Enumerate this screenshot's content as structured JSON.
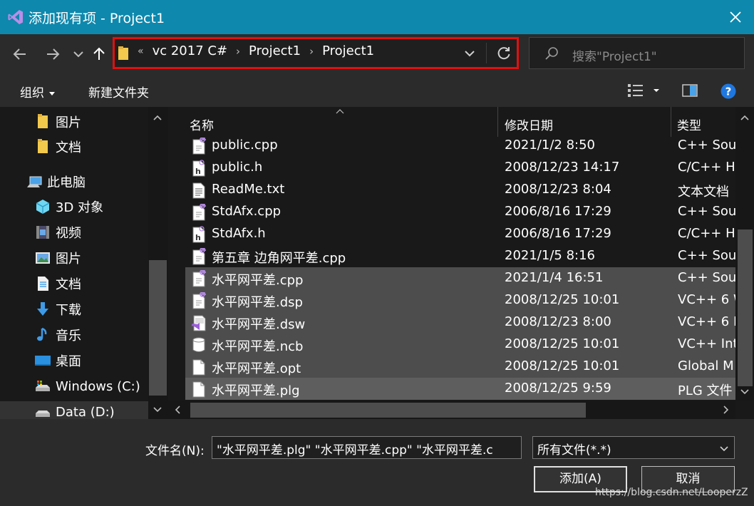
{
  "window": {
    "title": "添加现有项 - Project1",
    "close_label": "✕"
  },
  "address_bar": {
    "overflow": "«",
    "crumbs": [
      "vc 2017 C#",
      "Project1",
      "Project1"
    ]
  },
  "search": {
    "placeholder": "搜索\"Project1\""
  },
  "toolbar": {
    "organize": "组织",
    "new_folder": "新建文件夹"
  },
  "sidebar": {
    "items": [
      {
        "label": "图片",
        "icon": "folder-icon"
      },
      {
        "label": "文档",
        "icon": "folder-icon"
      },
      {
        "label": "此电脑",
        "icon": "computer-icon"
      },
      {
        "label": "3D 对象",
        "icon": "3d-objects-icon"
      },
      {
        "label": "视频",
        "icon": "video-icon"
      },
      {
        "label": "图片",
        "icon": "pictures-icon"
      },
      {
        "label": "文档",
        "icon": "documents-icon"
      },
      {
        "label": "下载",
        "icon": "download-icon"
      },
      {
        "label": "音乐",
        "icon": "music-icon"
      },
      {
        "label": "桌面",
        "icon": "desktop-icon"
      },
      {
        "label": "Windows (C:)",
        "icon": "drive-icon"
      },
      {
        "label": "Data (D:)",
        "icon": "drive-icon"
      }
    ]
  },
  "columns": {
    "name": "名称",
    "modified": "修改日期",
    "type": "类型"
  },
  "files": [
    {
      "name": "public.cpp",
      "date": "2021/1/2 8:50",
      "type": "C++ Sour",
      "icon": "cpp-file-icon",
      "selected": false
    },
    {
      "name": "public.h",
      "date": "2008/12/23 14:17",
      "type": "C/C++ He",
      "icon": "header-file-icon",
      "selected": false
    },
    {
      "name": "ReadMe.txt",
      "date": "2008/12/23 8:04",
      "type": "文本文档",
      "icon": "text-file-icon",
      "selected": false
    },
    {
      "name": "StdAfx.cpp",
      "date": "2006/8/16 17:29",
      "type": "C++ Sour",
      "icon": "cpp-file-icon",
      "selected": false
    },
    {
      "name": "StdAfx.h",
      "date": "2006/8/16 17:29",
      "type": "C/C++ He",
      "icon": "header-file-icon",
      "selected": false
    },
    {
      "name": "第五章 边角网平差.cpp",
      "date": "2021/1/5 8:16",
      "type": "C++ Sour",
      "icon": "cpp-file-icon",
      "selected": false
    },
    {
      "name": "水平网平差.cpp",
      "date": "2021/1/4 16:51",
      "type": "C++ Sour",
      "icon": "cpp-file-icon",
      "selected": true
    },
    {
      "name": "水平网平差.dsp",
      "date": "2008/12/25 10:01",
      "type": "VC++ 6 W",
      "icon": "cpp-file-icon",
      "selected": true
    },
    {
      "name": "水平网平差.dsw",
      "date": "2008/12/23 8:00",
      "type": "VC++ 6 P",
      "icon": "vs-workspace-icon",
      "selected": true
    },
    {
      "name": "水平网平差.ncb",
      "date": "2008/12/25 10:01",
      "type": "VC++ Inte",
      "icon": "database-file-icon",
      "selected": true
    },
    {
      "name": "水平网平差.opt",
      "date": "2008/12/25 10:01",
      "type": "Global M",
      "icon": "blank-file-icon",
      "selected": true
    },
    {
      "name": "水平网平差.plg",
      "date": "2008/12/25 9:59",
      "type": "PLG 文件",
      "icon": "blank-file-icon",
      "selected": true
    }
  ],
  "bottom": {
    "filename_label": "文件名(N):",
    "filename_value": "\"水平网平差.plg\" \"水平网平差.cpp\" \"水平网平差.c",
    "filter_value": "所有文件(*.*)",
    "add_button": "添加(A)",
    "cancel_button": "取消",
    "watermark": "https://blog.csdn.net/LooperzZ"
  },
  "colors": {
    "titlebar": "#0e88ad",
    "address_highlight": "#e01010",
    "selection": "#4d4d4d"
  }
}
